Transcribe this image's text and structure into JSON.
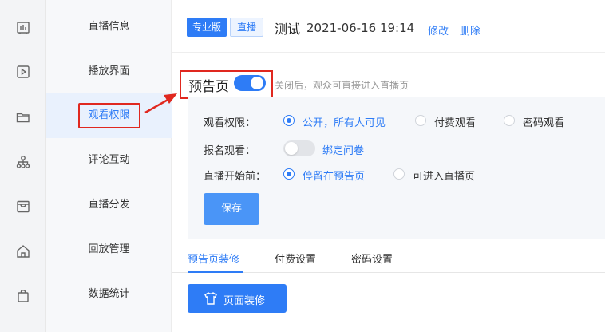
{
  "rail_icons": [
    "chart-icon",
    "video-play-icon",
    "folder-icon",
    "hierarchy-icon",
    "store-icon",
    "home-icon",
    "bag-icon"
  ],
  "menu": {
    "items": [
      "直播信息",
      "播放界面",
      "观看权限",
      "评论互动",
      "直播分发",
      "回放管理",
      "数据统计"
    ],
    "active_index": 2
  },
  "header": {
    "tag_pro": "专业版",
    "tag_live": "直播",
    "title": "测试",
    "date": "2021-06-16 19:14",
    "edit_link": "修改",
    "delete_link": "删除"
  },
  "preview": {
    "label": "预告页",
    "switch_on": true,
    "hint": "关闭后，观众可直接进入直播页"
  },
  "settings": {
    "permission_label": "观看权限：",
    "permission_options": [
      "公开，所有人可见",
      "付费观看",
      "密码观看"
    ],
    "permission_selected": 0,
    "signup_label": "报名观看：",
    "signup_on": false,
    "signup_link": "绑定问卷",
    "before_label": "直播开始前：",
    "before_options": [
      "停留在预告页",
      "可进入直播页"
    ],
    "before_selected": 0,
    "save_button": "保存"
  },
  "tabs": {
    "items": [
      "预告页装修",
      "付费设置",
      "密码设置"
    ],
    "active_index": 0
  },
  "decorate_button": "页面装修",
  "colors": {
    "accent": "#2e7cf6",
    "highlight_red": "#e0281f"
  }
}
